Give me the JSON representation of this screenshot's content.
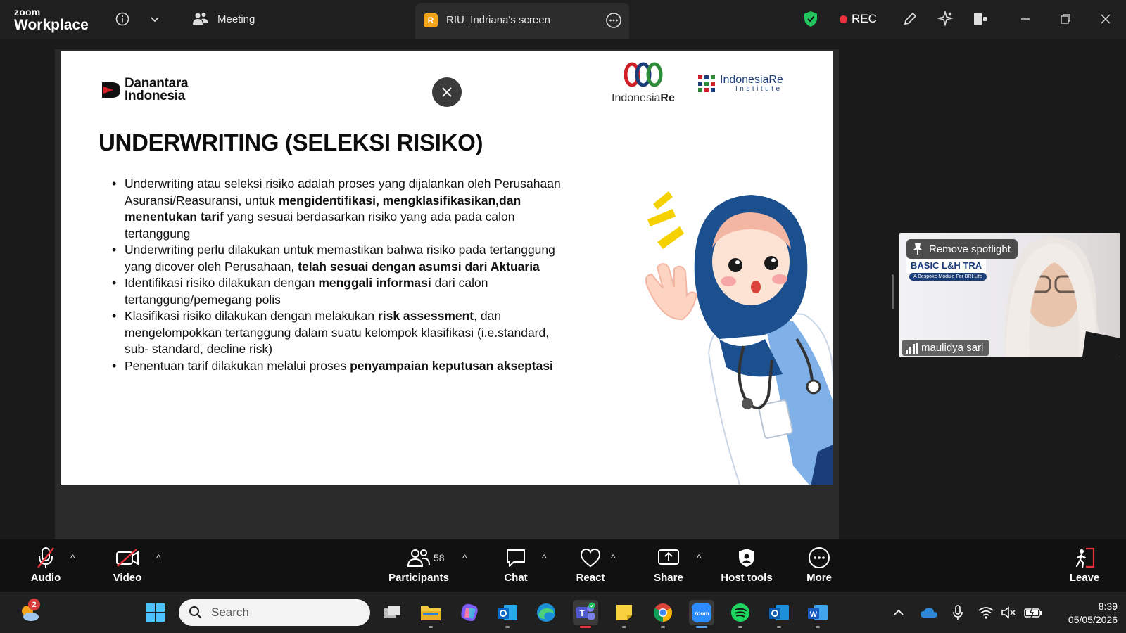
{
  "titlebar": {
    "brand_small": "zoom",
    "brand_big": "Workplace",
    "meeting_label": "Meeting",
    "shared_screen_badge": "R",
    "shared_screen_name": "RIU_Indriana's screen",
    "rec_label": "REC",
    "colors": {
      "bg": "#1f1f1f",
      "rec": "#e8323c",
      "shield": "#22c55e"
    }
  },
  "slide": {
    "logo_danantara_line1": "Danantara",
    "logo_danantara_line2": "Indonesia",
    "logo_indonesiare_a": "Indonesia",
    "logo_indonesiare_b": "Re",
    "logo_institute_main": "IndonesiaRe",
    "logo_institute_sub": "Institute",
    "title": "UNDERWRITING (SELEKSI RISIKO)",
    "bullets": [
      {
        "t1": "Underwriting atau seleksi risiko adalah proses yang dijalankan oleh Perusahaan Asuransi/Reasuransi, untuk ",
        "b1": "mengidentifikasi, mengklasifikasikan,dan menentukan tarif",
        "t2": " yang sesuai berdasarkan risiko yang ada pada calon tertanggung"
      },
      {
        "t1": "Underwriting perlu dilakukan untuk memastikan bahwa risiko pada tertanggung yang dicover oleh Perusahaan, ",
        "b1": "telah sesuai dengan asumsi dari Aktuaria",
        "t2": ""
      },
      {
        "t1": "Identifikasi risiko dilakukan dengan ",
        "b1": "menggali informasi",
        "t2": " dari calon tertanggung/pemegang polis"
      },
      {
        "t1": "Klasifikasi risiko dilakukan dengan melakukan ",
        "b1": "risk assessment",
        "t2": ", dan mengelompokkan tertanggung dalam suatu kelompok klasifikasi (i.e.standard, sub- standard, decline risk)"
      },
      {
        "t1": "Penentuan tarif dilakukan melalui proses ",
        "b1": "penyampaian keputusan akseptasi",
        "t2": ""
      }
    ]
  },
  "video": {
    "remove_spotlight": "Remove spotlight",
    "banner": "BASIC L&H TRA",
    "banner_sub": "A Bespoke Module For BRI Life",
    "participant_name": "maulidya sari"
  },
  "controls": {
    "audio": "Audio",
    "video": "Video",
    "participants": "Participants",
    "participants_count": "58",
    "chat": "Chat",
    "react": "React",
    "share": "Share",
    "host_tools": "Host tools",
    "more": "More",
    "leave": "Leave",
    "share_color": "#ffffff",
    "leave_color": "#e8323c"
  },
  "taskbar": {
    "weather_badge": "2",
    "search_placeholder": "Search",
    "time": "8:39",
    "date": "05/05/2026",
    "apps": [
      "windows-start",
      "task-view",
      "file-explorer",
      "copilot",
      "outlook",
      "edge",
      "teams",
      "sticky-notes",
      "chrome",
      "zoom",
      "spotify",
      "outlook-new",
      "word"
    ]
  }
}
